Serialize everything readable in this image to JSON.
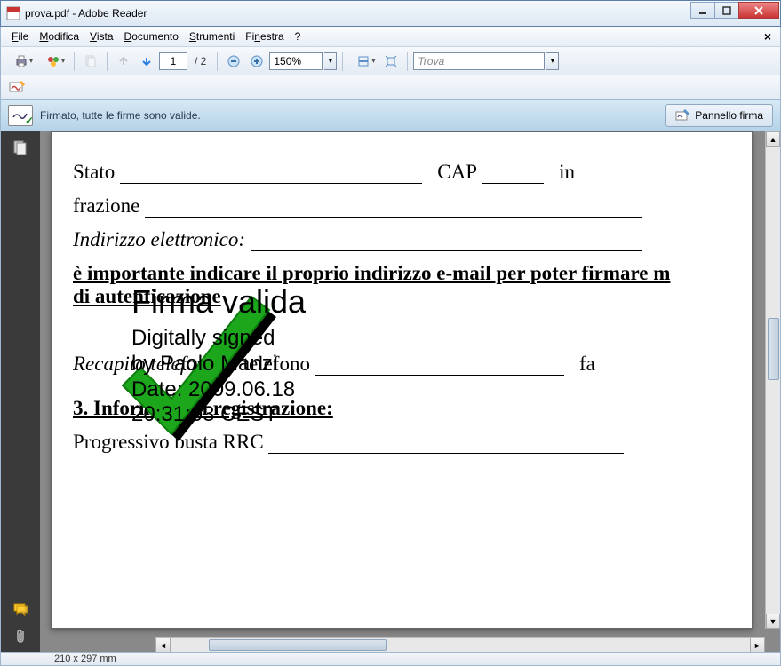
{
  "window": {
    "title": "prova.pdf - Adobe Reader"
  },
  "menu": {
    "file": "File",
    "modifica": "Modifica",
    "vista": "Vista",
    "documento": "Documento",
    "strumenti": "Strumenti",
    "finestra": "Finestra",
    "help": "?"
  },
  "toolbar": {
    "page_current": "1",
    "page_total": "/ 2",
    "zoom": "150%",
    "find_placeholder": "Trova"
  },
  "signature_banner": {
    "message": "Firmato, tutte le firme sono valide.",
    "panel_button": "Pannello firma"
  },
  "document": {
    "stato_label": "Stato",
    "cap_label": "CAP",
    "in_label": "in",
    "frazione_label": "frazione",
    "indirizzo_label": "Indirizzo elettronico:",
    "importante_line1": "è importante indicare il proprio indirizzo e-mail per poter firmare m",
    "importante_line2": "di autenticazione",
    "recapito_label": "Recapito telefonico:",
    "telefono_label": "telefono",
    "fa_label": "fa",
    "section3": "3. Informazioni registrazione:",
    "progressivo_label": "Progressivo busta RRC"
  },
  "signature_overlay": {
    "title": "Firma valida",
    "line1": "Digitally signed",
    "line2": "by Paolo Manzi",
    "line3": "Date: 2009.06.18",
    "line4": "20:31:03 CEST"
  },
  "statusbar": {
    "pagesize": "210 x 297 mm"
  }
}
